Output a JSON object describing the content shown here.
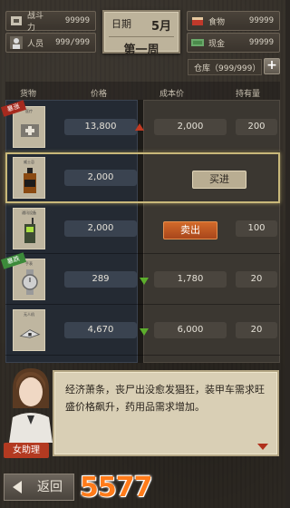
{
  "stats": {
    "combat": {
      "label": "战斗力",
      "value": "99999",
      "icon": "combat-power-icon"
    },
    "people": {
      "label": "人员",
      "value": "999/999",
      "icon": "person-icon"
    },
    "food": {
      "label": "食物",
      "value": "99999",
      "icon": "food-icon"
    },
    "cash": {
      "label": "现金",
      "value": "99999",
      "icon": "cash-icon"
    }
  },
  "date": {
    "label": "日期",
    "month": "5月",
    "week": "第一周"
  },
  "warehouse": {
    "text": "仓库（999/999）",
    "plus": "+"
  },
  "columns": {
    "item": "货物",
    "price": "价格",
    "cost": "成本价",
    "hold": "持有量"
  },
  "items": [
    {
      "name": "医疗",
      "tag": "暴涨",
      "tag_color": "red",
      "price": "13,800",
      "cost": "2,000",
      "hold": "200",
      "trend": "up",
      "icon": "medical-kit-icon"
    },
    {
      "name": "威士忌",
      "tag": "",
      "price": "2,000",
      "cost": "",
      "hold": "",
      "trend": "",
      "icon": "whiskey-bottle-icon",
      "action": "买进"
    },
    {
      "name": "通讯设备",
      "tag": "",
      "price": "2,000",
      "cost": "",
      "hold": "100",
      "trend": "",
      "icon": "radio-icon",
      "action": "卖出"
    },
    {
      "name": "手表",
      "tag": "暴跌",
      "tag_color": "green",
      "price": "289",
      "cost": "1,780",
      "hold": "20",
      "trend": "down",
      "icon": "watch-icon"
    },
    {
      "name": "无人机",
      "tag": "",
      "price": "4,670",
      "cost": "6,000",
      "hold": "20",
      "trend": "down",
      "icon": "drone-icon"
    }
  ],
  "dialog": {
    "speaker": "女助理",
    "text": "经济萧条，丧尸出没愈发猖狂，装甲车需求旺盛价格飙升，药用品需求增加。"
  },
  "back": "返回",
  "watermark": "5577.com"
}
